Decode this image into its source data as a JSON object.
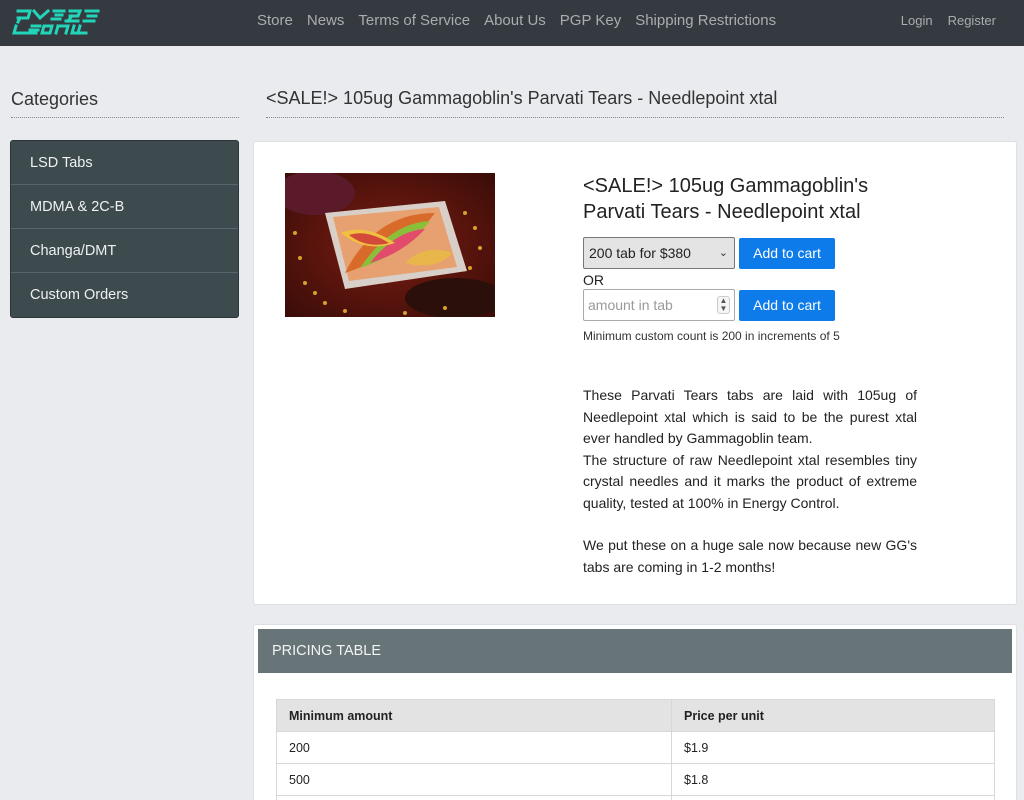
{
  "nav": {
    "logo": "PSYE LOCUM",
    "links": [
      "Store",
      "News",
      "Terms of Service",
      "About Us",
      "PGP Key",
      "Shipping Restrictions"
    ],
    "auth": [
      "Login",
      "Register"
    ]
  },
  "sidebar": {
    "title": "Categories",
    "items": [
      {
        "label": "LSD Tabs"
      },
      {
        "label": "MDMA & 2C-B"
      },
      {
        "label": "Changa/DMT"
      },
      {
        "label": "Custom Orders"
      }
    ]
  },
  "page": {
    "title": "<SALE!> 105ug Gammagoblin's Parvati Tears - Needlepoint xtal"
  },
  "product": {
    "title": "<SALE!> 105ug Gammagoblin's Parvati Tears - Needlepoint xtal",
    "selected_option": "200 tab for $380",
    "add_to_cart_label": "Add to cart",
    "or_label": "OR",
    "amount_placeholder": "amount in tab",
    "hint": "Minimum custom count is 200 in increments of 5",
    "description": [
      "These Parvati Tears tabs are laid with 105ug of Needlepoint xtal which is said to be the purest xtal ever handled by Gammagoblin team.",
      "The structure of raw Needlepoint xtal resembles tiny crystal needles and it marks the product of extreme quality, tested at 100% in Energy Control.",
      "We put these on a huge sale now because new GG's tabs are coming in 1-2 months!"
    ]
  },
  "pricing": {
    "heading": "PRICING TABLE",
    "columns": [
      "Minimum amount",
      "Price per unit"
    ],
    "rows": [
      [
        "200",
        "$1.9"
      ],
      [
        "500",
        "$1.8"
      ]
    ]
  }
}
